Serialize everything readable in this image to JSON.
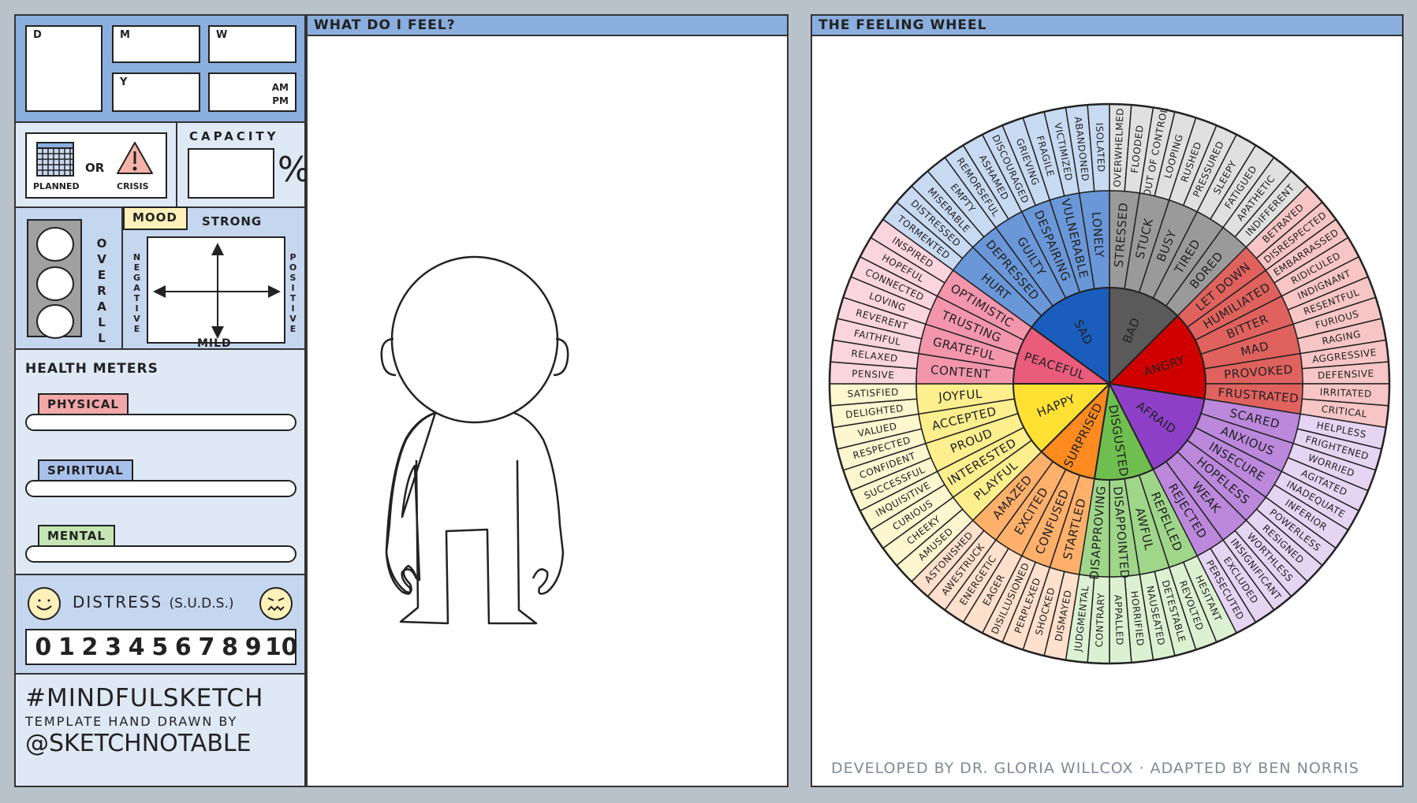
{
  "datetime": {
    "day_label": "D",
    "month_label": "M",
    "weekday_label": "W",
    "year_label": "Y",
    "am_label": "AM",
    "pm_label": "PM"
  },
  "planned_or_crisis": {
    "planned_label": "PLANNED",
    "or_label": "OR",
    "crisis_label": "CRISIS"
  },
  "capacity": {
    "title": "CAPACITY",
    "unit": "%"
  },
  "overall": {
    "label": "OVERALL"
  },
  "mood": {
    "title": "MOOD",
    "top": "STRONG",
    "bottom": "MILD",
    "left": "NEGATIVE",
    "right": "POSITIVE"
  },
  "health_meters": {
    "title": "HEALTH METERS",
    "items": [
      {
        "label": "PHYSICAL",
        "color": "#f2a7a8"
      },
      {
        "label": "SPIRITUAL",
        "color": "#a8c1ea"
      },
      {
        "label": "MENTAL",
        "color": "#c5e6b4"
      }
    ]
  },
  "distress": {
    "title": "DISTRESS",
    "subtitle": "(S.U.D.S.)",
    "scale": [
      "0",
      "1",
      "2",
      "3",
      "4",
      "5",
      "6",
      "7",
      "8",
      "9",
      "10"
    ]
  },
  "credits_left": {
    "hashtag": "#MINDFULSKETCH",
    "line": "TEMPLATE HAND DRAWN BY",
    "handle": "@SKETCHNOTABLE"
  },
  "what_do_i_feel": {
    "title": "WHAT DO I FEEL?"
  },
  "feeling_wheel": {
    "title": "THE FEELING WHEEL",
    "credit": "DEVELOPED BY DR. GLORIA WILLCOX · ADAPTED BY BEN NORRIS",
    "cores": [
      {
        "name": "BAD",
        "color": "#5a5a5a",
        "mid_color": "#9a9a9a",
        "outer_color": "#e0e0e0",
        "middle": [
          {
            "w": "STRESSED",
            "outer": [
              "OVERWHELMED",
              "FLOODED"
            ]
          },
          {
            "w": "STUCK",
            "outer": [
              "OUT OF CONTROL",
              "LOOPING"
            ]
          },
          {
            "w": "BUSY",
            "outer": [
              "RUSHED",
              "PRESSURED"
            ]
          },
          {
            "w": "TIRED",
            "outer": [
              "SLEEPY",
              "FATIGUED"
            ]
          },
          {
            "w": "BORED",
            "outer": [
              "APATHETIC",
              "INDIFFERENT"
            ]
          }
        ]
      },
      {
        "name": "ANGRY",
        "color": "#d10000",
        "mid_color": "#e0625e",
        "outer_color": "#f7c5c5",
        "middle": [
          {
            "w": "LET DOWN",
            "outer": [
              "BETRAYED",
              "DISRESPECTED"
            ]
          },
          {
            "w": "HUMILIATED",
            "outer": [
              "EMBARRASSED",
              "RIDICULED"
            ]
          },
          {
            "w": "BITTER",
            "outer": [
              "INDIGNANT",
              "RESENTFUL"
            ]
          },
          {
            "w": "MAD",
            "outer": [
              "FURIOUS",
              "RAGING"
            ]
          },
          {
            "w": "PROVOKED",
            "outer": [
              "AGGRESSIVE",
              "DEFENSIVE"
            ]
          },
          {
            "w": "FRUSTRATED",
            "outer": [
              "IRRITATED",
              "CRITICAL"
            ]
          }
        ]
      },
      {
        "name": "AFRAID",
        "color": "#8e3fc7",
        "mid_color": "#bb88dc",
        "outer_color": "#e6d4f3",
        "middle": [
          {
            "w": "SCARED",
            "outer": [
              "HELPLESS",
              "FRIGHTENED"
            ]
          },
          {
            "w": "ANXIOUS",
            "outer": [
              "WORRIED",
              "AGITATED"
            ]
          },
          {
            "w": "INSECURE",
            "outer": [
              "INADEQUATE",
              "INFERIOR"
            ]
          },
          {
            "w": "HOPELESS",
            "outer": [
              "POWERLESS",
              "RESIGNED"
            ]
          },
          {
            "w": "WEAK",
            "outer": [
              "WORTHLESS",
              "INSIGNIFICANT"
            ]
          },
          {
            "w": "REJECTED",
            "outer": [
              "EXCLUDED",
              "PERSECUTED"
            ]
          }
        ]
      },
      {
        "name": "DISGUSTED",
        "color": "#6ebf4f",
        "mid_color": "#9fd68a",
        "outer_color": "#dcf1d2",
        "middle": [
          {
            "w": "REPELLED",
            "outer": [
              "HESITANT",
              "REVOLTED"
            ]
          },
          {
            "w": "AWFUL",
            "outer": [
              "DETESTABLE",
              "NAUSEATED"
            ]
          },
          {
            "w": "DISAPPOINTED",
            "outer": [
              "HORRIFIED",
              "APPALLED"
            ]
          },
          {
            "w": "DISAPPROVING",
            "outer": [
              "CONTRARY",
              "JUDGMENTAL"
            ]
          }
        ]
      },
      {
        "name": "SURPRISED",
        "color": "#ff8a1f",
        "mid_color": "#ffb06b",
        "outer_color": "#ffe0cc",
        "middle": [
          {
            "w": "STARTLED",
            "outer": [
              "DISMAYED",
              "SHOCKED"
            ]
          },
          {
            "w": "CONFUSED",
            "outer": [
              "PERPLEXED",
              "DISILLUSIONED"
            ]
          },
          {
            "w": "EXCITED",
            "outer": [
              "EAGER",
              "ENERGETIC"
            ]
          },
          {
            "w": "AMAZED",
            "outer": [
              "AWESTRUCK",
              "ASTONISHED"
            ]
          }
        ]
      },
      {
        "name": "HAPPY",
        "color": "#ffe134",
        "mid_color": "#fdee8e",
        "outer_color": "#fdf6cf",
        "middle": [
          {
            "w": "PLAYFUL",
            "outer": [
              "AMUSED",
              "CHEEKY"
            ]
          },
          {
            "w": "INTERESTED",
            "outer": [
              "CURIOUS",
              "INQUISITIVE"
            ]
          },
          {
            "w": "PROUD",
            "outer": [
              "SUCCESSFUL",
              "CONFIDENT"
            ]
          },
          {
            "w": "ACCEPTED",
            "outer": [
              "RESPECTED",
              "VALUED"
            ]
          },
          {
            "w": "JOYFUL",
            "outer": [
              "DELIGHTED",
              "SATISFIED"
            ]
          }
        ]
      },
      {
        "name": "PEACEFUL",
        "color": "#ea5b7c",
        "mid_color": "#f396ac",
        "outer_color": "#fad4de",
        "middle": [
          {
            "w": "CONTENT",
            "outer": [
              "PENSIVE",
              "RELAXED"
            ]
          },
          {
            "w": "GRATEFUL",
            "outer": [
              "FAITHFUL",
              "REVERENT"
            ]
          },
          {
            "w": "TRUSTING",
            "outer": [
              "LOVING",
              "CONNECTED"
            ]
          },
          {
            "w": "OPTIMISTIC",
            "outer": [
              "HOPEFUL",
              "INSPIRED"
            ]
          }
        ]
      },
      {
        "name": "SAD",
        "color": "#1a5dbd",
        "mid_color": "#6a97d8",
        "outer_color": "#c8daf1",
        "middle": [
          {
            "w": "HURT",
            "outer": [
              "TORMENTED",
              "DISTRESSED"
            ]
          },
          {
            "w": "DEPRESSED",
            "outer": [
              "MISERABLE",
              "EMPTY"
            ]
          },
          {
            "w": "GUILTY",
            "outer": [
              "REMORSEFUL",
              "ASHAMED"
            ]
          },
          {
            "w": "DESPAIRING",
            "outer": [
              "DISCOURAGED",
              "GRIEVING"
            ]
          },
          {
            "w": "VULNERABLE",
            "outer": [
              "FRAGILE",
              "VICTIMIZED"
            ]
          },
          {
            "w": "LONELY",
            "outer": [
              "ABANDONED",
              "ISOLATED"
            ]
          }
        ]
      }
    ]
  }
}
